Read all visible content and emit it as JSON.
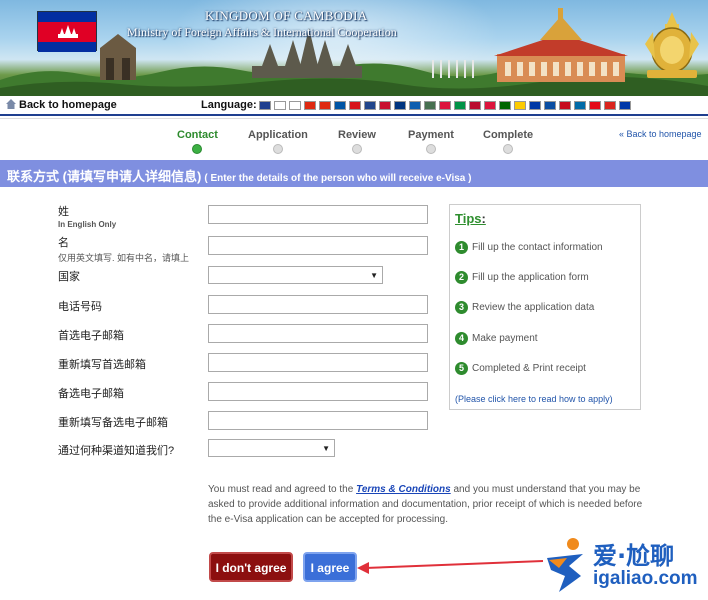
{
  "banner": {
    "title": "KINGDOM OF CAMBODIA",
    "subtitle": "Ministry of Foreign Affairs & International Cooperation"
  },
  "nav": {
    "back_label": "Back to homepage",
    "language_label": "Language:",
    "flag_colors": [
      "#1f3f8f",
      "#ffffff",
      "#ffffff",
      "#de2910",
      "#de2910",
      "#0055a4",
      "#d7141a",
      "#21468b",
      "#c8102e",
      "#003580",
      "#0d5eaf",
      "#477050",
      "#dc143c",
      "#009246",
      "#ba0c2f",
      "#dc143c",
      "#006600",
      "#fecb00",
      "#0039a6",
      "#0b4ea2",
      "#c60b1e",
      "#006aa7",
      "#e30a17",
      "#da251d",
      "#0038a8"
    ]
  },
  "steps": {
    "items": [
      {
        "label": "Contact",
        "active": true
      },
      {
        "label": "Application",
        "active": false
      },
      {
        "label": "Review",
        "active": false
      },
      {
        "label": "Payment",
        "active": false
      },
      {
        "label": "Complete",
        "active": false
      }
    ],
    "back_link": "« Back to homepage"
  },
  "section": {
    "title_cn": "联系方式 (请填写申请人详细信息)",
    "title_en": "( Enter the details of the person who will receive e-Visa )"
  },
  "form": {
    "surname_label": "姓",
    "surname_hint": "In English Only",
    "given_name_label": "名",
    "given_name_hint": "仅用英文填写. 如有中名，请填上",
    "country_label": "国家",
    "country_value": "",
    "phone_label": "电话号码",
    "email_label": "首选电子邮箱",
    "email_confirm_label": "重新填写首选邮箱",
    "alt_email_label": "备选电子邮箱",
    "alt_email_confirm_label": "重新填写备选电子邮箱",
    "source_label": "通过何种渠道知道我们?",
    "source_value": ""
  },
  "tips": {
    "title": "Tips",
    "items": [
      {
        "num": "1",
        "text": "Fill up the contact information"
      },
      {
        "num": "2",
        "text": "Fill up the application form"
      },
      {
        "num": "3",
        "text": "Review the application data"
      },
      {
        "num": "4",
        "text": "Make payment"
      },
      {
        "num": "5",
        "text": "Completed & Print receipt"
      }
    ],
    "link": "(Please click here to read how to apply)"
  },
  "terms": {
    "before": "You must read and agreed to the ",
    "link": "Terms & Conditions",
    "after": " and you must understand that you may be asked to provide additional information and documentation, prior receipt of which is needed before the e-Visa application can be accepted for processing."
  },
  "buttons": {
    "disagree": "I don't agree",
    "agree": "I agree"
  },
  "watermark": {
    "cn": "爱·尬聊",
    "url": "igaliao.com"
  },
  "colors": {
    "accent_green": "#2e8b2e",
    "section_bar": "#7f8fe0",
    "agree_blue": "#3b6fd8",
    "disagree_red": "#8c0f0f",
    "annotation_arrow": "#e0303a"
  }
}
